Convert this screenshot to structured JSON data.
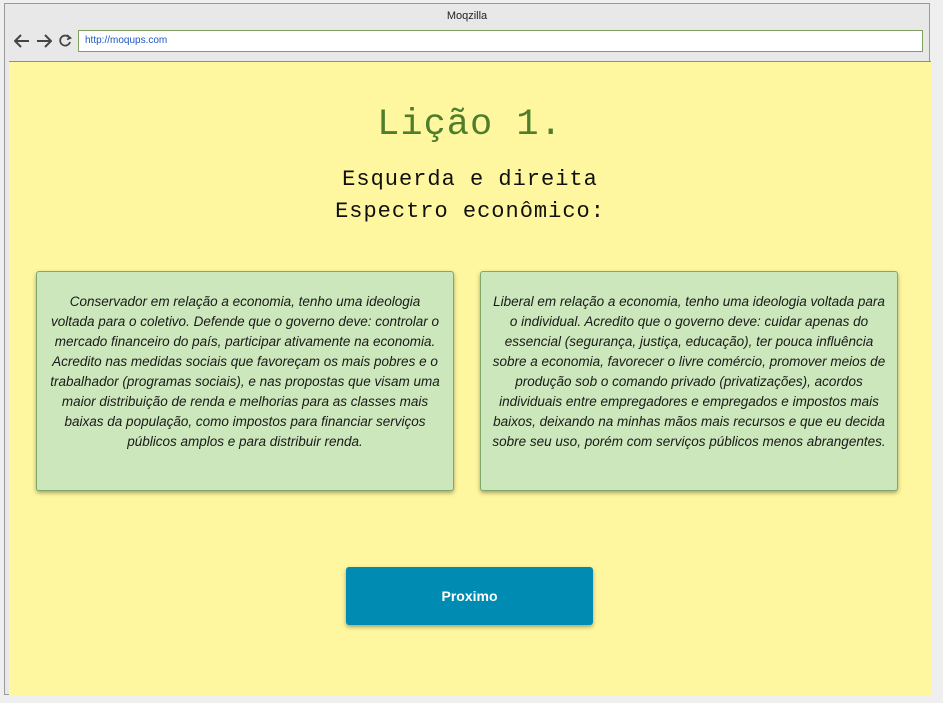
{
  "browser": {
    "title": "Moqzilla",
    "url": "http://moqups.com",
    "nav_icons": [
      "back-icon",
      "forward-icon",
      "reload-icon"
    ]
  },
  "page": {
    "title": "Lição 1.",
    "subtitle_line1": "Esquerda e direita",
    "subtitle_line2": "Espectro econômico:",
    "left_card": "Conservador em relação a economia, tenho uma ideologia voltada para o coletivo. Defende que o governo deve: controlar o mercado financeiro do país, participar ativamente na economia. Acredito nas medidas sociais que favoreçam os mais pobres e o trabalhador (programas sociais), e nas propostas que visam uma maior distribuição de renda e melhorias para as classes mais baixas da população, como impostos para financiar serviços públicos amplos e para distribuir renda.",
    "right_card": "Liberal em relação a economia, tenho uma ideologia voltada para o individual. Acredito que o governo deve: cuidar apenas do essencial (segurança, justiça, educação), ter pouca influência sobre a economia, favorecer o livre comércio, promover meios de produção sob o comando privado (privatizações), acordos individuais entre empregadores e empregados e impostos mais baixos, deixando na minhas mãos mais recursos e que eu decida sobre seu uso, porém com serviços públicos menos abrangentes.",
    "next_label": "Proximo"
  },
  "colors": {
    "page_bg": "#fff79f",
    "card_bg": "#cce7bb",
    "title": "#4e7d2b",
    "button": "#008bb3"
  }
}
